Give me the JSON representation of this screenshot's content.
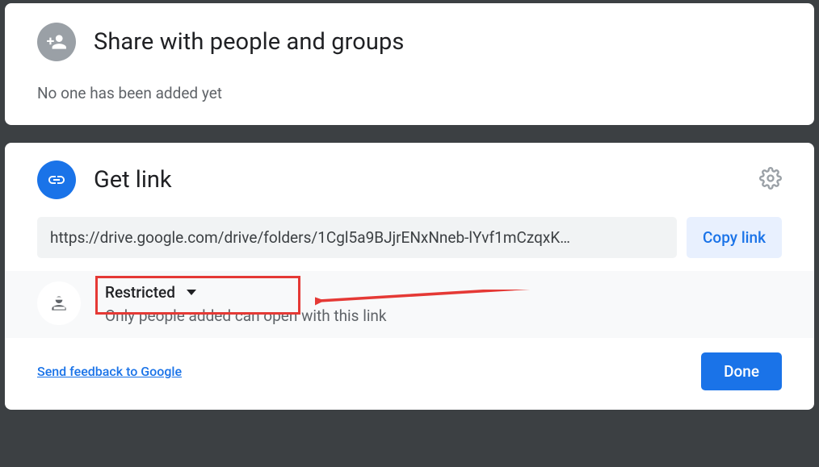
{
  "share": {
    "title": "Share with people and groups",
    "emptyText": "No one has been added yet"
  },
  "link": {
    "title": "Get link",
    "url": "https://drive.google.com/drive/folders/1Cgl5a9BJjrENxNneb-lYvf1mCzqxK…",
    "copyLabel": "Copy link",
    "accessLabel": "Restricted",
    "accessDesc": "Only people added can open with this link",
    "feedbackLabel": "Send feedback to Google",
    "doneLabel": "Done"
  }
}
